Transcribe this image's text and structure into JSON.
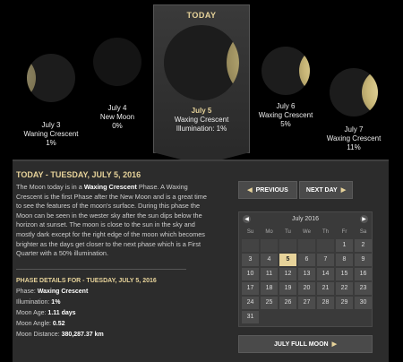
{
  "today_header": "TODAY",
  "moons": [
    {
      "date": "July 3",
      "phase": "Waning Crescent",
      "illum": "1%"
    },
    {
      "date": "July 4",
      "phase": "New Moon",
      "illum": "0%"
    },
    {
      "date": "July 5",
      "phase": "Waxing Crescent",
      "illum": "Illumination: 1%"
    },
    {
      "date": "July 6",
      "phase": "Waxing Crescent",
      "illum": "5%"
    },
    {
      "date": "July 7",
      "phase": "Waxing Crescent",
      "illum": "11%"
    }
  ],
  "main": {
    "title_prefix": "TODAY",
    "title_date": " - TUESDAY, JULY 5, 2016",
    "desc_1": "The Moon today is in a ",
    "desc_phase": "Waxing Crescent",
    "desc_2": " Phase. A Waxing Crescent is the first Phase after the New Moon and is a great time to see the features of the moon's surface. During this phase the Moon can be seen in the wester sky after the sun dips below the horizon at sunset. The moon is close to the sun in the sky and mostly dark except for the right edge of the moon which becomes brighter as the days get closer to the next phase which is a First Quarter with a 50% illumination."
  },
  "details": {
    "title": "PHASE DETAILS FOR - TUESDAY, JULY 5, 2016",
    "phase_label": "Phase: ",
    "phase_value": "Waxing Crescent",
    "illum_label": "Illumination: ",
    "illum_value": "1%",
    "age_label": "Moon Age: ",
    "age_value": "1.11 days",
    "angle_label": "Moon Angle: ",
    "angle_value": "0.52",
    "distance_label": "Moon Distance: ",
    "distance_value": "380,287.37 km"
  },
  "buttons": {
    "previous": "PREVIOUS",
    "next": "NEXT DAY",
    "full_moon": "JULY FULL MOON"
  },
  "calendar": {
    "month": "July 2016",
    "dow": [
      "Su",
      "Mo",
      "Tu",
      "We",
      "Th",
      "Fr",
      "Sa"
    ],
    "cells": [
      "",
      "",
      "",
      "",
      "",
      "1",
      "2",
      "3",
      "4",
      "5",
      "6",
      "7",
      "8",
      "9",
      "10",
      "11",
      "12",
      "13",
      "14",
      "15",
      "16",
      "17",
      "18",
      "19",
      "20",
      "21",
      "22",
      "23",
      "24",
      "25",
      "26",
      "27",
      "28",
      "29",
      "30",
      "31"
    ],
    "selected": "5"
  },
  "colors": {
    "accent": "#e7d39a",
    "panel": "#2c2c2c"
  }
}
